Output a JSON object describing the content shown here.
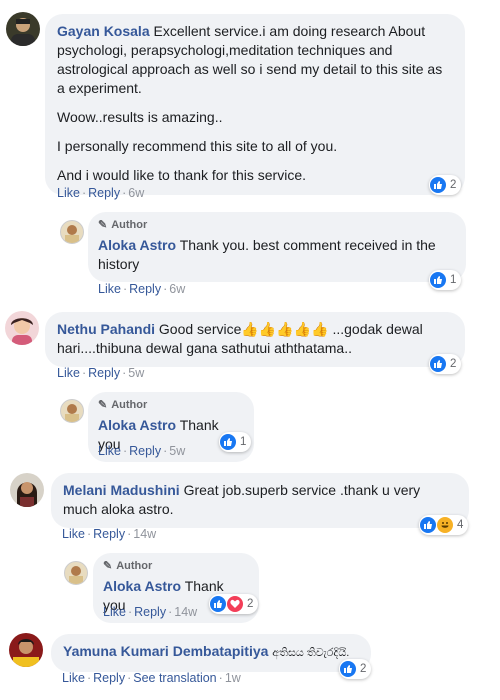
{
  "actions": {
    "like": "Like",
    "reply": "Reply",
    "see_translation": "See translation"
  },
  "author_badge": "Author",
  "colors": {
    "link": "#365899",
    "bubble": "#f0f2f5",
    "like": "#1877f2",
    "love": "#f33e58",
    "haha": "#f7b125"
  },
  "comments": [
    {
      "name": "Gayan Kosala",
      "text_first": "Excellent service.i am doing research About psychologi, perapsychologi,meditation techniques and astrological approach as well so i send my detail to this site as a experiment.",
      "paragraphs": [
        "Woow..results is amazing..",
        "I personally recommend this site to all of you.",
        "And i would like to thank for this service."
      ],
      "time": "6w",
      "reaction_count": "2",
      "reply": {
        "name": "Aloka Astro",
        "text": "Thank you. best comment received in the history",
        "time": "6w",
        "reaction_count": "1"
      }
    },
    {
      "name": "Nethu Pahandi",
      "text": "Good service",
      "emojis": "👍👍👍👍👍",
      "text_after": "...godak dewal hari....thibuna dewal gana sathutui aththatama..",
      "time": "5w",
      "reaction_count": "2",
      "reply": {
        "name": "Aloka Astro",
        "text": "Thank you",
        "time": "5w",
        "reaction_count": "1"
      }
    },
    {
      "name": "Melani Madushini",
      "text": "Great job.superb service .thank u very much aloka astro.",
      "time": "14w",
      "reaction_count": "4",
      "reply": {
        "name": "Aloka Astro",
        "text": "Thank you",
        "time": "14w",
        "reaction_count": "2"
      }
    },
    {
      "name": "Yamuna Kumari Dembatapitiya",
      "text": "අතිසය තිවැරදියි.",
      "time": "1w",
      "reaction_count": "2"
    }
  ]
}
